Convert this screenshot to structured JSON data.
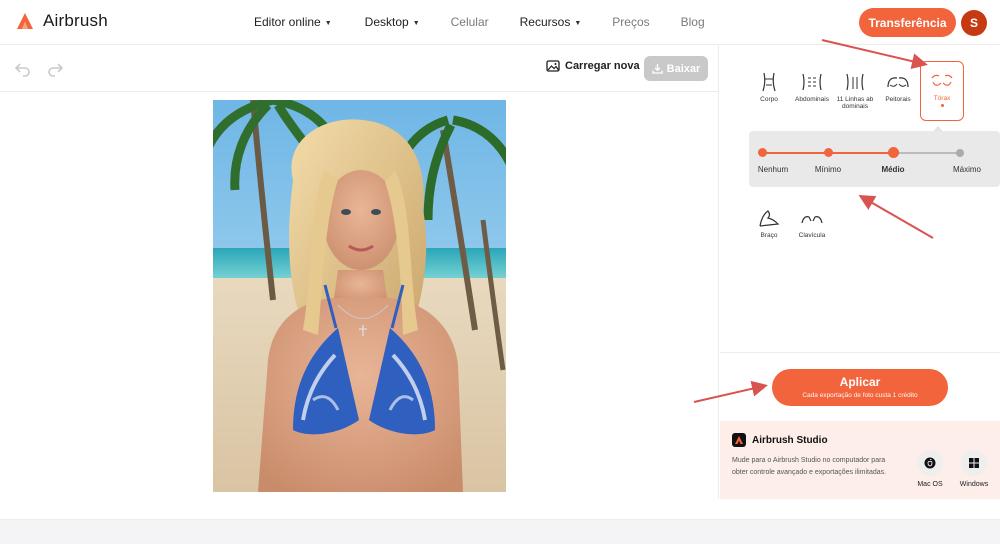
{
  "brand": {
    "name": "Airbrush",
    "accent": "#f2643c"
  },
  "nav": {
    "items": [
      {
        "label": "Editor online",
        "dropdown": true
      },
      {
        "label": "Desktop",
        "dropdown": true
      },
      {
        "label": "Celular",
        "dropdown": false
      },
      {
        "label": "Recursos",
        "dropdown": true
      },
      {
        "label": "Preços",
        "dropdown": false
      },
      {
        "label": "Blog",
        "dropdown": false
      }
    ],
    "transfer_label": "Transferência",
    "avatar_initial": "S"
  },
  "toolbar": {
    "upload_label": "Carregar nova",
    "download_label": "Baixar"
  },
  "body_tools": {
    "items": [
      {
        "label": "Corpo",
        "icon": "body-shape-icon",
        "selected": false
      },
      {
        "label": "Abdominais",
        "icon": "abs-icon",
        "selected": false
      },
      {
        "label": "11 Linhas ab dominais",
        "icon": "ab-lines-icon",
        "selected": false
      },
      {
        "label": "Peitorais",
        "icon": "pecs-icon",
        "selected": false
      },
      {
        "label": "Tórax",
        "icon": "chest-icon",
        "selected": true
      }
    ],
    "secondary": [
      {
        "label": "Braço",
        "icon": "arm-icon"
      },
      {
        "label": "Clavícula",
        "icon": "collarbone-icon"
      }
    ]
  },
  "intensity": {
    "options": [
      "Nenhum",
      "Mínimo",
      "Médio",
      "Máximo"
    ],
    "selected": "Médio",
    "selected_index": 2
  },
  "apply": {
    "label": "Aplicar",
    "note": "Cada exportação de foto custa 1 crédito"
  },
  "studio": {
    "title": "Airbrush Studio",
    "description": "Mude para o Airbrush Studio no computador para obter controle avançado e exportações ilimitadas.",
    "platforms": [
      {
        "label": "Mac OS",
        "icon": "apple-icon"
      },
      {
        "label": "Windows",
        "icon": "windows-icon"
      }
    ]
  },
  "annotation_color": "#d9534f"
}
